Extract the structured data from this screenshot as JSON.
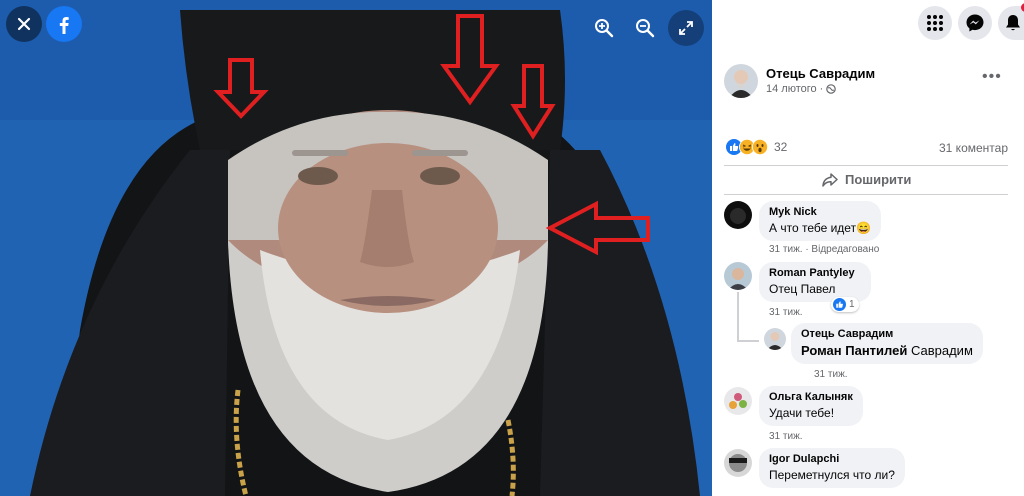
{
  "viewer": {
    "close_icon": "close-icon",
    "logo_icon": "facebook-logo-icon",
    "zoom_in_icon": "zoom-in-icon",
    "zoom_out_icon": "zoom-out-icon",
    "fullscreen_icon": "fullscreen-icon"
  },
  "colors": {
    "accent": "#1877f2",
    "background_photo": "#1f5fae",
    "arrow_red": "#e02020",
    "text_secondary": "#65676b"
  },
  "post": {
    "author": "Отець Саврадим",
    "date": "14 лютого",
    "date_separator": "·",
    "reactions_count": "32",
    "comments_count": "31 коментар",
    "share_label": "Поширити"
  },
  "comments": [
    {
      "name": "Myk Nick",
      "text": "А что тебе идет😄",
      "time": "31 тиж.",
      "edited": "· Відредаговано"
    },
    {
      "name": "Roman Pantyley",
      "text": "Отец Павел",
      "time": "31 тиж.",
      "likes": "1"
    },
    {
      "name": "Отець Саврадим",
      "mention": "Роман Пантилей",
      "text": " Саврадим",
      "time": "31 тиж."
    },
    {
      "name": "Ольга Калыняк",
      "text": "Удачи тебе!",
      "time": "31 тиж."
    },
    {
      "name": "Igor Dulapchi",
      "text": "Переметнулся что ли?"
    }
  ]
}
